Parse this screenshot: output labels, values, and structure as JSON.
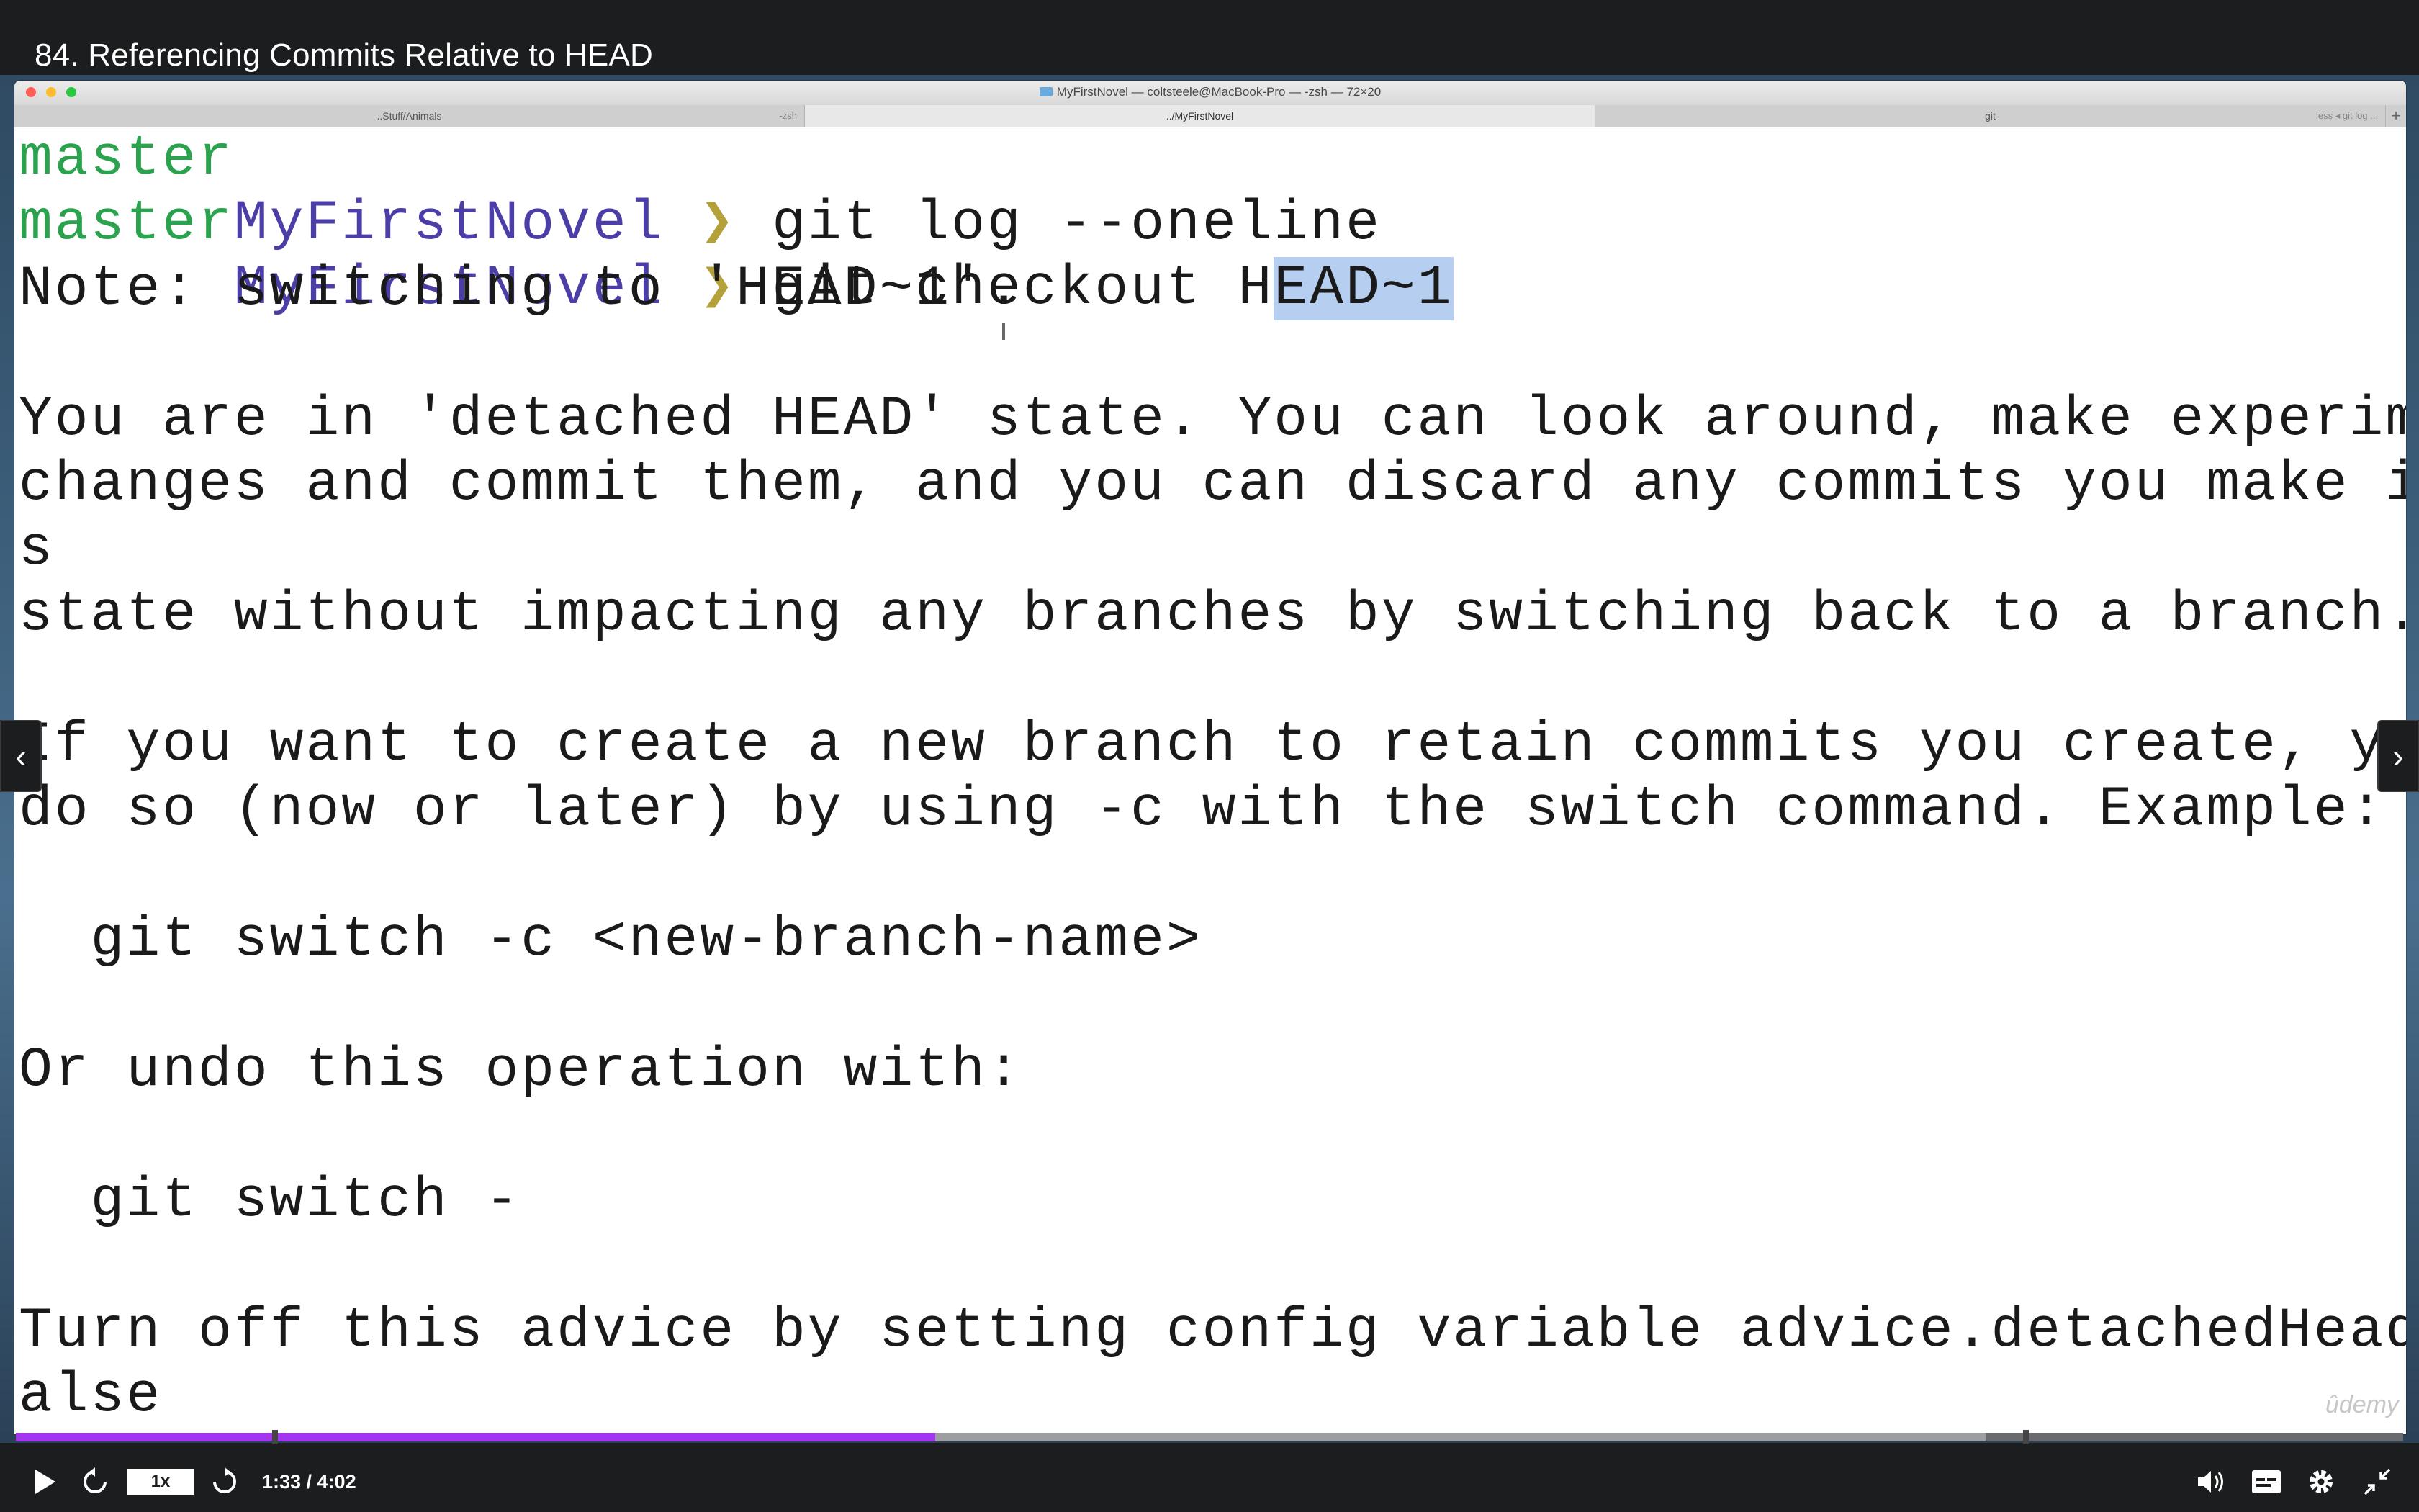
{
  "course": {
    "title": "84. Referencing Commits Relative to HEAD"
  },
  "window": {
    "title": "MyFirstNovel — coltsteele@MacBook-Pro — -zsh — 72×20",
    "tabs": [
      {
        "label": "..Stuff/Animals",
        "sub": "-zsh"
      },
      {
        "label": "../MyFirstNovel",
        "sub": ""
      },
      {
        "label": "git",
        "sub": "less ◂ git log ..."
      }
    ]
  },
  "terminal": {
    "prompt1": {
      "dir": "MyFirstNovel",
      "arrow": "❯",
      "cmd": "git log --oneline",
      "branch": "master"
    },
    "prompt2": {
      "dir": "MyFirstNovel",
      "arrow": "❯",
      "cmd_pre": "git checkout H",
      "cmd_sel": "EAD~1",
      "branch": "master"
    },
    "lines": [
      "Note: switching to 'HEAD~1'.",
      "You are in 'detached HEAD' state. You can look around, make experimental",
      "changes and commit them, and you can discard any commits you make in thi",
      "s",
      "state without impacting any branches by switching back to a branch.",
      "If you want to create a new branch to retain commits you create, you may",
      "do so (now or later) by using -c with the switch command. Example:",
      "  git switch -c <new-branch-name>",
      "Or undo this operation with:",
      "  git switch -",
      "Turn off this advice by setting config variable advice.detachedHead to f",
      "alse"
    ]
  },
  "player": {
    "speed": "1x",
    "time": "1:33 / 4:02",
    "progress_fraction": 0.385,
    "buffer_fraction": 0.825,
    "watermark": "ûdemy"
  },
  "colors": {
    "accent": "#a435f0",
    "prompt": "#4b3fa7",
    "branch": "#2ba24e",
    "selection": "#b6cff0"
  }
}
